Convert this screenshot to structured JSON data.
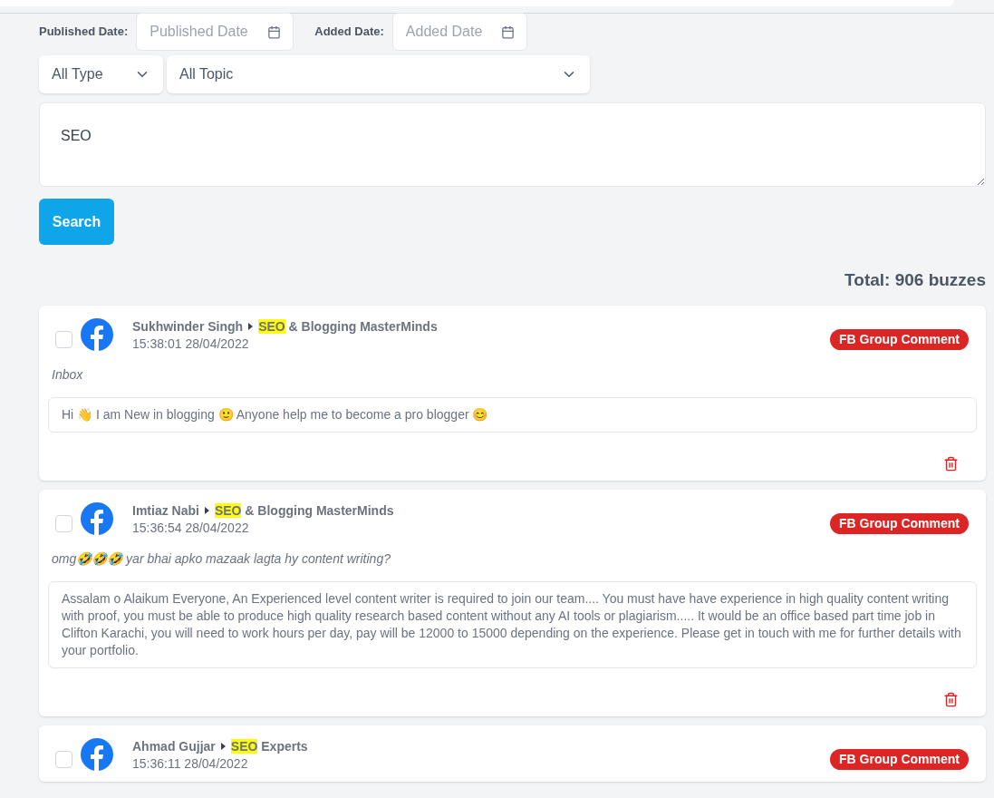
{
  "filters": {
    "published_label": "Published Date:",
    "published_placeholder": "Published Date",
    "added_label": "Added Date:",
    "added_placeholder": "Added Date",
    "type_select": "All Type",
    "topic_select": "All Topic"
  },
  "query": "SEO",
  "search_button": "Search",
  "total": "Total: 906 buzzes",
  "posts": [
    {
      "author": "Sukhwinder Singh",
      "group_match": "SEO",
      "group_rest": " & Blogging MasterMinds",
      "time": "15:38:01 28/04/2022",
      "badge": "FB Group Comment",
      "checked": false,
      "comment": "Inbox",
      "post": "Hi 👋 I am New in blogging 🙂 Anyone help me to become a pro blogger 😊"
    },
    {
      "author": "Imtiaz Nabi",
      "group_match": "SEO",
      "group_rest": " & Blogging MasterMinds",
      "time": "15:36:54 28/04/2022",
      "badge": "FB Group Comment",
      "checked": false,
      "comment": "omg🤣🤣🤣 yar bhai apko mazaak lagta hy content writing?",
      "post": "Assalam o Alaikum Everyone, An Experienced level content writer is required to join our team.... You must have have experience in high quality content writing with proof, you must be able to produce high quality research based content without any AI tools or plagiarism..... It would be an office based part time job in Clifton Karachi, you will need to work hours per day, pay will be 12000 to 15000 depending on the experience. Please get in touch with me for further details with your portfolio."
    },
    {
      "author": "Ahmad Gujjar",
      "group_match": "SEO",
      "group_rest": " Experts",
      "time": "15:36:11 28/04/2022",
      "badge": "FB Group Comment",
      "checked": false
    }
  ]
}
